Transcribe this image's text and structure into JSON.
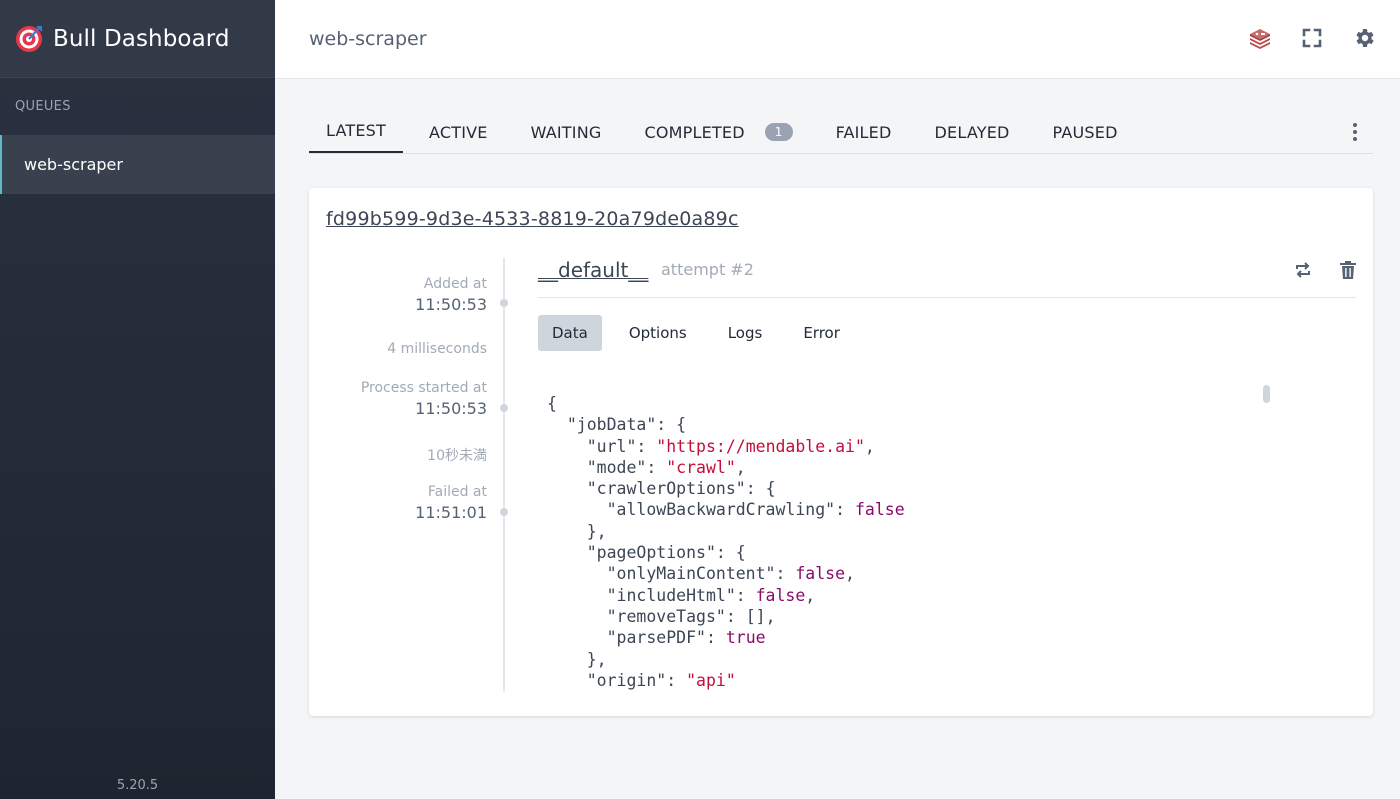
{
  "sidebar": {
    "title": "Bull Dashboard",
    "queues_heading": "QUEUES",
    "queues": [
      {
        "label": "web-scraper"
      }
    ],
    "version": "5.20.5"
  },
  "header": {
    "title": "web-scraper",
    "icons": [
      "redis-stack-icon",
      "fullscreen-icon",
      "settings-gear-icon"
    ]
  },
  "tabs": [
    {
      "label": "LATEST",
      "active": true
    },
    {
      "label": "ACTIVE"
    },
    {
      "label": "WAITING"
    },
    {
      "label": "COMPLETED",
      "badge": "1"
    },
    {
      "label": "FAILED"
    },
    {
      "label": "DELAYED"
    },
    {
      "label": "PAUSED"
    }
  ],
  "job": {
    "id": "fd99b599-9d3e-4533-8819-20a79de0a89c",
    "name": "__default__",
    "attempt": "attempt #2",
    "timeline": {
      "added_label": "Added at",
      "added_time": "11:50:53",
      "wait_duration": "4 milliseconds",
      "started_label": "Process started at",
      "started_time": "11:50:53",
      "process_duration": "10秒未満",
      "failed_label": "Failed at",
      "failed_time": "11:51:01"
    },
    "subtabs": [
      {
        "label": "Data",
        "active": true
      },
      {
        "label": "Options"
      },
      {
        "label": "Logs"
      },
      {
        "label": "Error"
      }
    ],
    "data_lines": [
      "{",
      "  \"jobData\": {",
      "    \"url\": \"https://mendable.ai\",",
      "    \"mode\": \"crawl\",",
      "    \"crawlerOptions\": {",
      "      \"allowBackwardCrawling\": false",
      "    },",
      "    \"pageOptions\": {",
      "      \"onlyMainContent\": false,",
      "      \"includeHtml\": false,",
      "      \"removeTags\": [],",
      "      \"parsePDF\": true",
      "    },",
      "    \"origin\": \"api\"",
      "  }"
    ]
  },
  "colors": {
    "sidebar_bg": "#2a3140",
    "active_queue_accent": "#5fb8c4",
    "string_color": "#c40e3b",
    "boolean_color": "#8b0a6a"
  }
}
